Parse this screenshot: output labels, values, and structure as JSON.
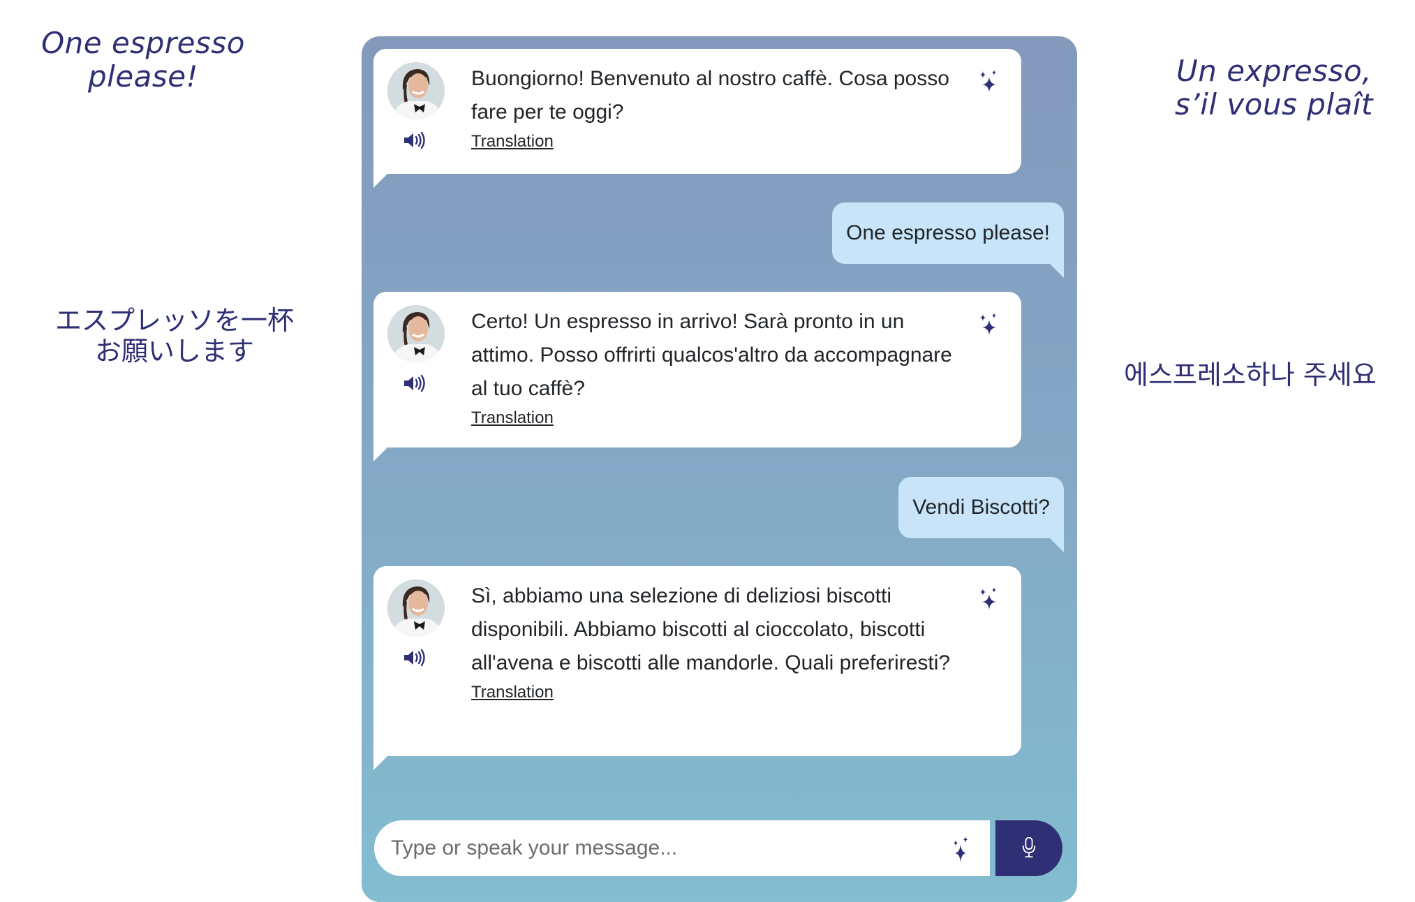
{
  "side_phrases": {
    "english": "One espresso please!",
    "french": "Un expresso, s’il vous plaît",
    "japanese": "エスプレッソを一杯お願いします",
    "korean": "에스프레소하나 주세요"
  },
  "side_lines": {
    "english": [
      "One espresso",
      "please!"
    ],
    "french": [
      "Un expresso,",
      "s’il vous plaît"
    ],
    "japanese": [
      "エスプレッソを一杯",
      "お願いします"
    ],
    "korean": [
      "에스프레소하나 주세요"
    ]
  },
  "chat": {
    "messages": [
      {
        "role": "bot",
        "text": "Buongiorno! Benvenuto al nostro caffè. Cosa posso fare per te oggi?",
        "translation_label": "Translation"
      },
      {
        "role": "user",
        "text": "One espresso please!"
      },
      {
        "role": "bot",
        "text": "Certo! Un espresso in arrivo! Sarà pronto in un attimo. Posso offrirti qualcos'altro da accompagnare al tuo caffè?",
        "translation_label": "Translation"
      },
      {
        "role": "user",
        "text": "Vendi Biscotti?"
      },
      {
        "role": "bot",
        "text": "Sì, abbiamo una selezione di deliziosi biscotti disponibili. Abbiamo biscotti al cioccolato, biscotti all'avena e biscotti alle mandorle. Quali preferiresti?",
        "translation_label": "Translation"
      }
    ],
    "input": {
      "value": "",
      "placeholder": "Type or speak your message..."
    }
  },
  "icons": {
    "avatar": "waiter-avatar",
    "speaker": "speaker-icon",
    "sparkle": "sparkle-icon",
    "microphone": "microphone-icon"
  },
  "colors": {
    "accent": "#2e2f74",
    "gradient_top": "#8499bc",
    "gradient_bottom": "#83bdcf",
    "user_bubble": "#c7e4f8",
    "bot_bubble": "#ffffff"
  }
}
